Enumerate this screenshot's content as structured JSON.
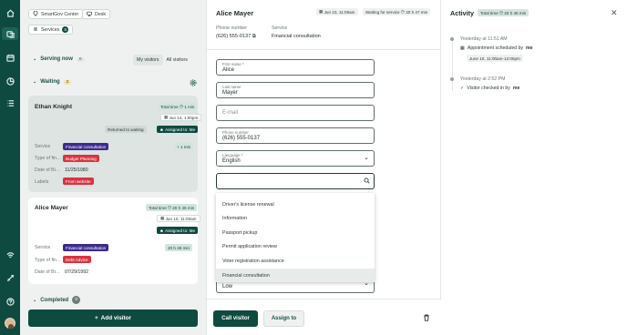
{
  "left": {
    "location_chip": "SmartGov Center",
    "desk_chip": "Desk",
    "services_chip": "Services",
    "services_count": "6",
    "serving_now": "Serving now",
    "serving_count": "0",
    "tab_my": "My visitors",
    "tab_all": "All visitors",
    "waiting": "Waiting",
    "waiting_count": "2",
    "completed": "Completed",
    "completed_count": "0",
    "add_visitor": "Add visitor"
  },
  "cards": [
    {
      "name": "Ethan Knight",
      "total_time": "Total time",
      "time_value": "1 min",
      "date": "Jun 13, 1:00pm",
      "returned": "Returned to waiting",
      "assigned": "Assigned to: Me",
      "service_label": "Service",
      "service": "Financial consultation",
      "delta": "+ 1 min",
      "type_label": "Type of fin…",
      "type_value": "Budget Planning",
      "dob_label": "Date of Bi…",
      "dob": "11/25/1980",
      "labels_label": "Labels",
      "label_value": "From website"
    },
    {
      "name": "Alice Mayer",
      "total_time": "Total time",
      "time_value": "20 h 46 min",
      "date": "Jun 10, 11:00am",
      "assigned": "Assigned to: Me",
      "service_label": "Service",
      "service": "Financial consultation",
      "delta": "20 h 46 min",
      "type_label": "Type of fin…",
      "type_value": "Debt Advice",
      "dob_label": "Date of Bi…",
      "dob": "07/29/1992"
    }
  ],
  "detail": {
    "name": "Alice Mayer",
    "date_chip": "Jun 10, 11:00am",
    "waiting_chip": "Waiting for service",
    "waiting_time": "20 h 47 min",
    "phone_label": "Phone number",
    "phone": "(626) 555-0137",
    "service_label": "Service",
    "service": "Financial consultation",
    "first_name_label": "First name *",
    "first_name": "Alice",
    "last_name_label": "Last name",
    "last_name": "Mayer",
    "email_placeholder": "E-mail",
    "phone_field_label": "Phone number",
    "phone_field": "(626) 555-0137",
    "language_label": "Language *",
    "language": "English",
    "priority": "Low",
    "options": [
      "Driver's license renewal",
      "Information",
      "Passport pickup",
      "Permit application review",
      "Voter registration assistance",
      "Financial consultation"
    ],
    "call": "Call visitor",
    "assign": "Assign to"
  },
  "activity": {
    "title": "Activity",
    "total_time": "Total time",
    "total_value": "20 h 46 min",
    "e1_time": "Yesterday at 11:51 AM",
    "e1_text": "Appointment scheduled by",
    "e1_by": "me",
    "e1_chip": "June 10, 11:00am-12:00pm",
    "e2_time": "Yesterday at 2:52 PM",
    "e2_text": "Visitor checked in by",
    "e2_by": "me"
  }
}
